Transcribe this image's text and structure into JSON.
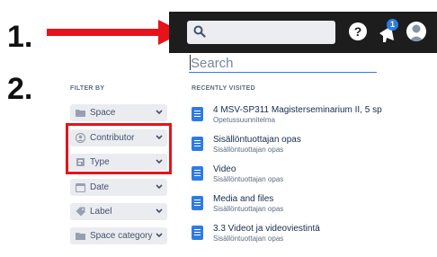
{
  "annotations": {
    "step1": "1.",
    "step2": "2."
  },
  "colors": {
    "annotation_red": "#e8121b",
    "topbar_bg": "#1d1d1d",
    "accent_blue": "#2e7be6"
  },
  "topbar": {
    "search_placeholder": "",
    "help_label": "?",
    "notification_count": "1"
  },
  "search": {
    "placeholder": "Search"
  },
  "filters": {
    "title": "FILTER BY",
    "items": [
      {
        "label": "Space",
        "icon": "folder-icon"
      },
      {
        "label": "Contributor",
        "icon": "person-icon"
      },
      {
        "label": "Type",
        "icon": "page-type-icon"
      },
      {
        "label": "Date",
        "icon": "calendar-icon"
      },
      {
        "label": "Label",
        "icon": "tag-icon"
      },
      {
        "label": "Space category",
        "icon": "folder-icon"
      }
    ]
  },
  "recent": {
    "title": "RECENTLY VISITED",
    "items": [
      {
        "title": "4 MSV-SP311 Magisterseminarium II, 5 sp",
        "subtitle": "Opetussuunnitelma"
      },
      {
        "title": "Sisällöntuottajan opas",
        "subtitle": "Sisällöntuottajan opas"
      },
      {
        "title": "Video",
        "subtitle": "Sisällöntuottajan opas"
      },
      {
        "title": "Media and files",
        "subtitle": "Sisällöntuottajan opas"
      },
      {
        "title": "3.3 Videot ja videoviestintä",
        "subtitle": "Sisällöntuottajan opas"
      }
    ]
  }
}
